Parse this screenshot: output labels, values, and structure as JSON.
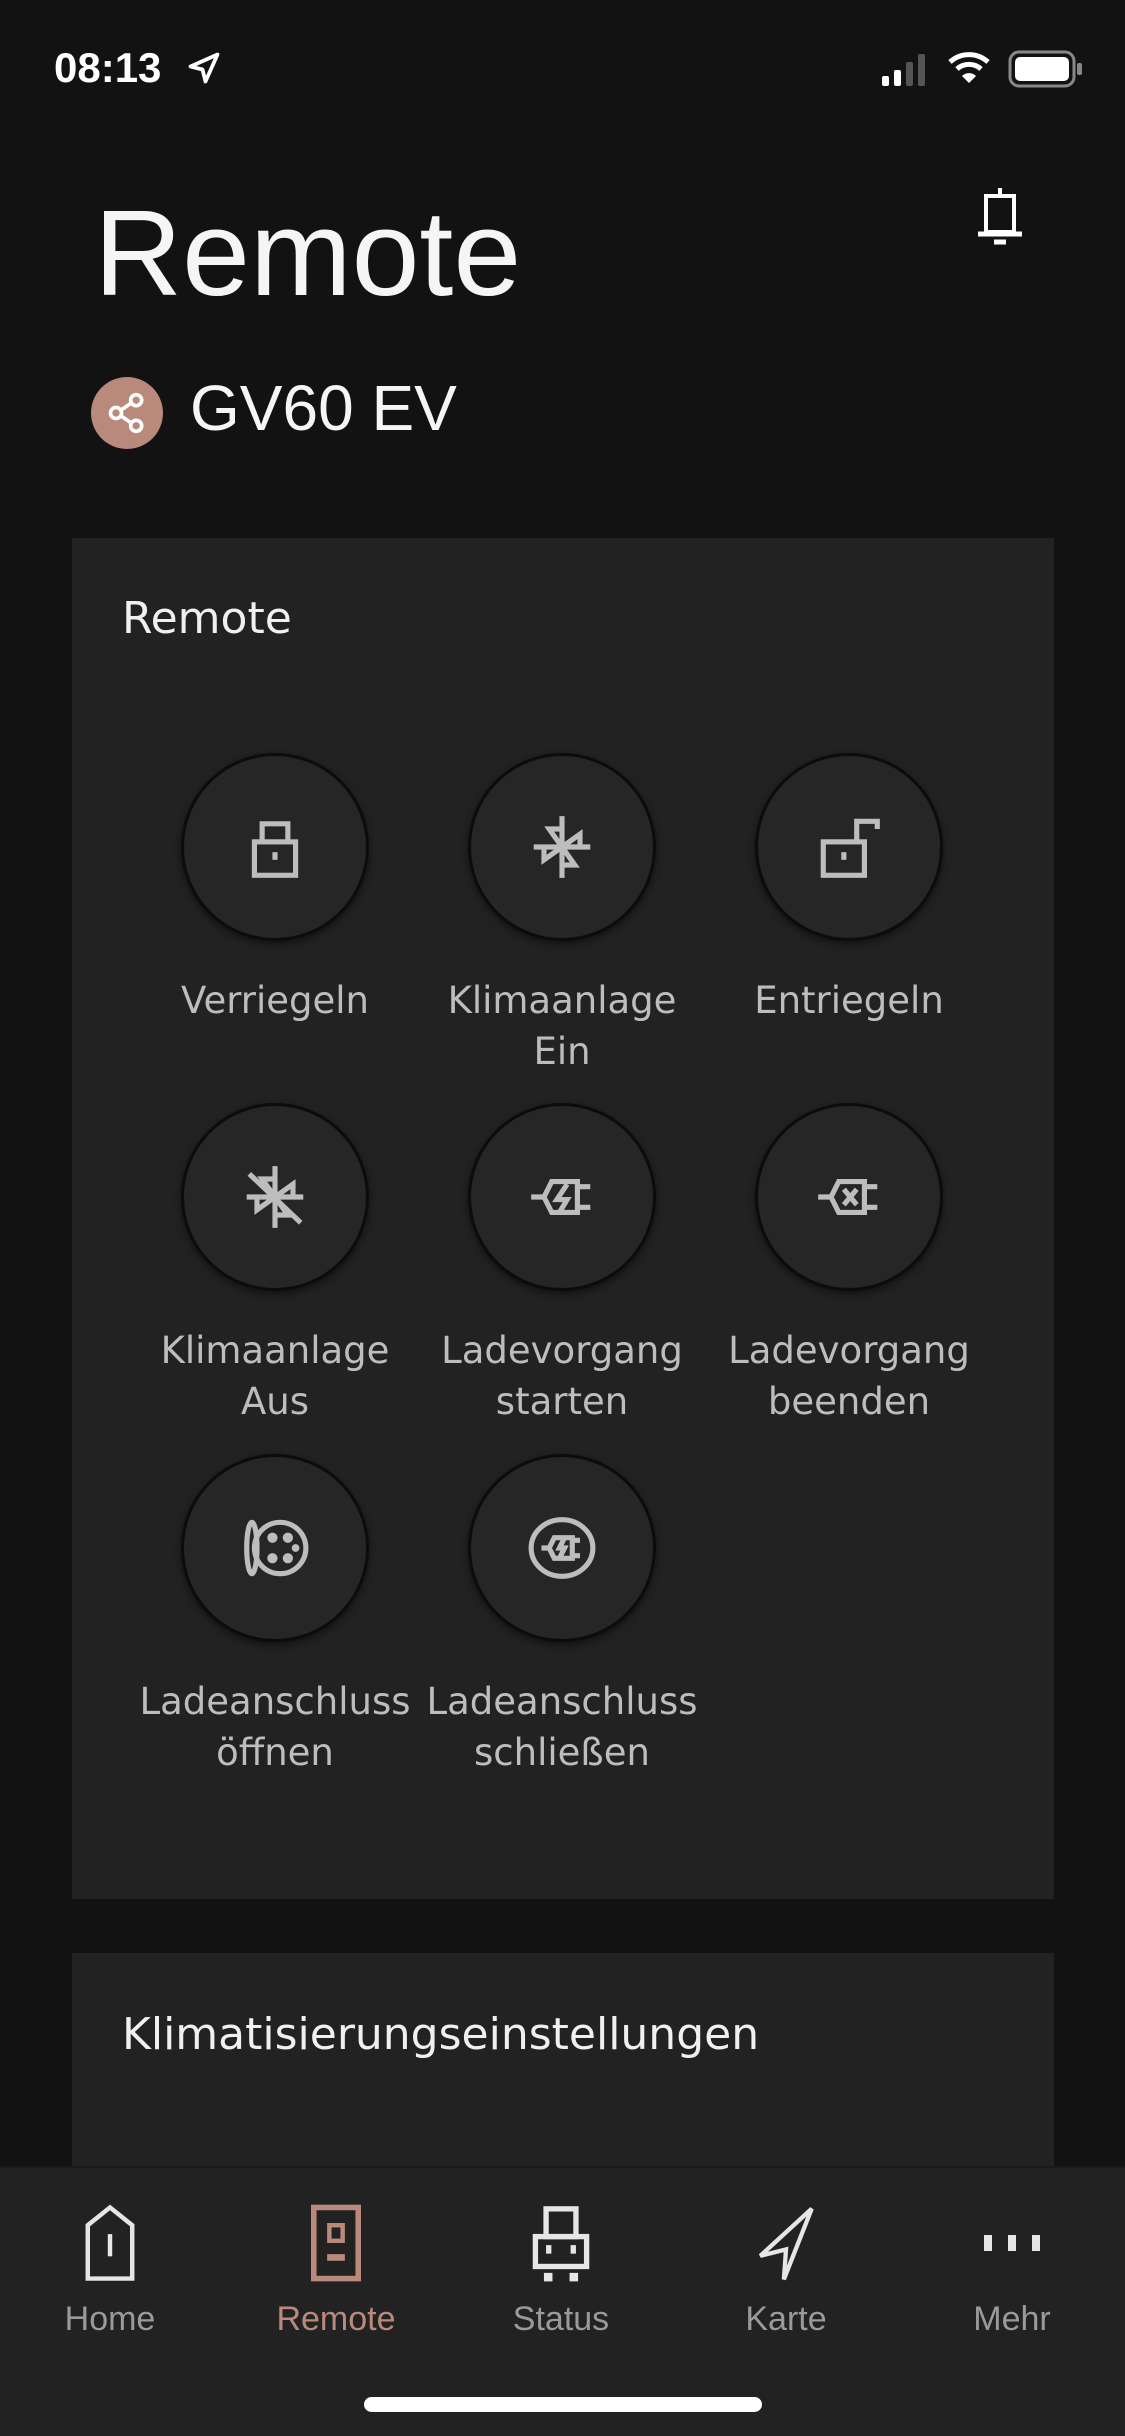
{
  "status_bar": {
    "time": "08:13"
  },
  "header": {
    "title": "Remote",
    "vehicle": "GV60 EV"
  },
  "remote_card": {
    "title": "Remote",
    "buttons": [
      {
        "label": "Verriegeln",
        "icon": "lock-icon"
      },
      {
        "label": "Klimaanlage Ein",
        "icon": "fan-icon"
      },
      {
        "label": "Entriegeln",
        "icon": "unlock-icon"
      },
      {
        "label": "Klimaanlage\nAus",
        "icon": "fan-off-icon"
      },
      {
        "label": "Ladevorgang\nstarten",
        "icon": "charge-start-icon"
      },
      {
        "label": "Ladevorgang\nbeenden",
        "icon": "charge-stop-icon"
      },
      {
        "label": "Ladeanschluss\nöffnen",
        "icon": "charge-port-open-icon"
      },
      {
        "label": "Ladeanschluss\nschließen",
        "icon": "charge-port-close-icon"
      }
    ]
  },
  "climate_card": {
    "title": "Klimatisierungseinstellungen"
  },
  "tabbar": {
    "active": "Remote",
    "accent": "#b98a7b",
    "items": [
      {
        "label": "Home"
      },
      {
        "label": "Remote"
      },
      {
        "label": "Status"
      },
      {
        "label": "Karte"
      },
      {
        "label": "Mehr"
      }
    ]
  }
}
